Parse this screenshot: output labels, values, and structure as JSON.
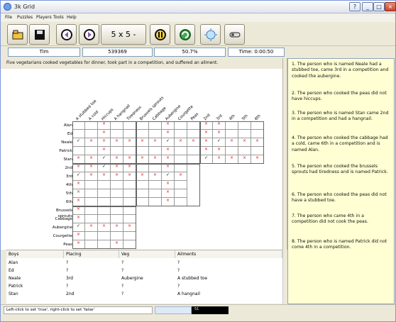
{
  "window": {
    "title": "3k Grid"
  },
  "menubar": {
    "items": [
      "File",
      "Puzzles",
      "Players",
      "Tools",
      "Help"
    ]
  },
  "toolbar": {
    "size_label": "5 x 5",
    "size_arrow": "-"
  },
  "status": {
    "player": "Tim",
    "score": "539369",
    "percent": "50.7%",
    "time": "Time: 0:00:50"
  },
  "intro": "Five vegetarians cooked vegetables for dinner, took part in a competition, and suffered an ailment.",
  "grid": {
    "column_headers": [
      "A stubbed toe",
      "A cold",
      "Hiccups",
      "A hangnail",
      "Tiredness",
      "Brussels sprouts",
      "Cabbage",
      "Aubergine",
      "Courgette",
      "Peas",
      "2nd",
      "3rd",
      "4th",
      "5th",
      "6th"
    ],
    "row_headers": [
      "Alan",
      "Ed",
      "Neale",
      "Patrick",
      "Stan",
      "2nd",
      "3rd",
      "4th",
      "5th",
      "6th",
      "Brussels sprouts",
      "Cabbage",
      "Aubergine",
      "Courgette",
      "Peas"
    ],
    "marks": {
      "Alan": "..x....x..xx...",
      "Ed": "..x....x..xx...",
      "Neale": "vxxxxxxvxxxvxxx",
      "Patrick": "..x....x..xx...",
      "Stan": "xxvxxxxx..vxxxx",
      "2nd": "xxvxx..x.",
      "3rd": "vxxxxxxvx",
      "4th": "x......x.",
      "5th": "x......x.",
      "6th": "x......x.",
      "Brussels sprouts": "x....",
      "Cabbage": "x....",
      "Aubergine": "vxxxx",
      "Courgette": "x....",
      "Peas": "x..x."
    }
  },
  "results": {
    "headers": [
      "Boys",
      "Placing",
      "Veg",
      "Ailments"
    ],
    "rows": [
      [
        "Alan",
        "?",
        "?",
        "?"
      ],
      [
        "Ed",
        "?",
        "?",
        "?"
      ],
      [
        "Neale",
        "3rd",
        "Aubergine",
        "A stubbed toe"
      ],
      [
        "Patrick",
        "?",
        "?",
        "?"
      ],
      [
        "Stan",
        "2nd",
        "?",
        "A hangnail"
      ]
    ]
  },
  "clues": [
    "1. The person who is named Neale had a stubbed toe, came 3rd in a competition and cooked the aubergine.",
    "2. The person who cooked the peas did not have hiccups.",
    "3. The person who is named Stan came 2nd in a competition and had a hangnail.",
    "4. The person who cooked the cabbage had a cold, came 6th in a competition and is named Alan.",
    "5. The person who cooked the brussels sprouts had tiredness and is named Patrick.",
    "6. The person who cooked the peas did not have a stubbed toe.",
    "7. The person who came 4th in a competition did not cook the peas.",
    "8. The person who is named Patrick did not come 4th in a competition."
  ],
  "statusbar": {
    "hint": "Left-click to set 'true', right-click to set 'false'",
    "counter": "51"
  },
  "colors": {
    "panel": "#ffffd3",
    "cross": "#d11",
    "window": "#ece9d8"
  }
}
